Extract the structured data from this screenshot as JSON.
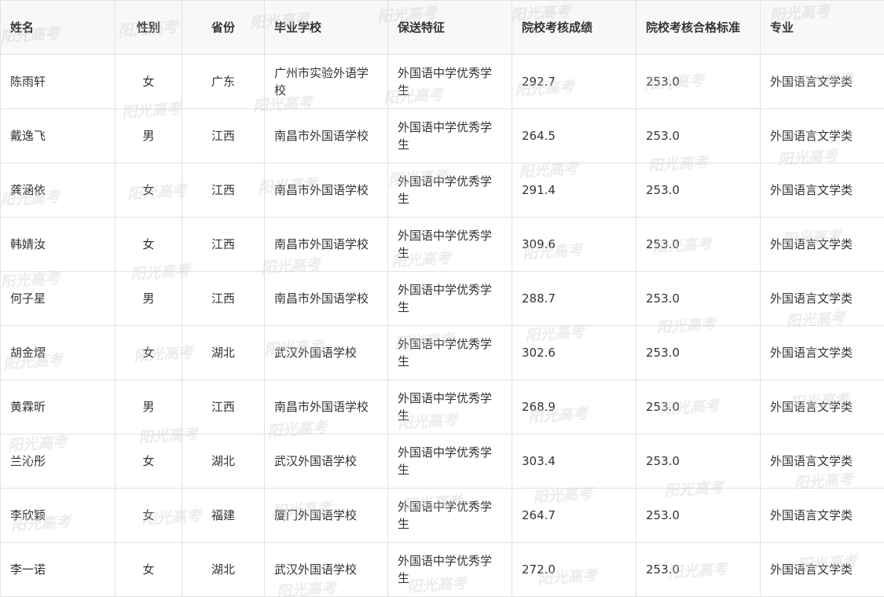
{
  "headers": {
    "name": "姓名",
    "gender": "性别",
    "province": "省份",
    "school": "毕业学校",
    "feature": "保送特征",
    "score": "院校考核成绩",
    "standard": "院校考核合格标准",
    "major": "专业"
  },
  "rows": [
    {
      "name": "陈雨轩",
      "gender": "女",
      "province": "广东",
      "school": "广州市实验外语学校",
      "feature": "外国语中学优秀学生",
      "score": "292.7",
      "standard": "253.0",
      "major": "外国语言文学类"
    },
    {
      "name": "戴逸飞",
      "gender": "男",
      "province": "江西",
      "school": "南昌市外国语学校",
      "feature": "外国语中学优秀学生",
      "score": "264.5",
      "standard": "253.0",
      "major": "外国语言文学类"
    },
    {
      "name": "龚涵依",
      "gender": "女",
      "province": "江西",
      "school": "南昌市外国语学校",
      "feature": "外国语中学优秀学生",
      "score": "291.4",
      "standard": "253.0",
      "major": "外国语言文学类"
    },
    {
      "name": "韩婧汝",
      "gender": "女",
      "province": "江西",
      "school": "南昌市外国语学校",
      "feature": "外国语中学优秀学生",
      "score": "309.6",
      "standard": "253.0",
      "major": "外国语言文学类"
    },
    {
      "name": "何子星",
      "gender": "男",
      "province": "江西",
      "school": "南昌市外国语学校",
      "feature": "外国语中学优秀学生",
      "score": "288.7",
      "standard": "253.0",
      "major": "外国语言文学类"
    },
    {
      "name": "胡金熠",
      "gender": "女",
      "province": "湖北",
      "school": "武汉外国语学校",
      "feature": "外国语中学优秀学生",
      "score": "302.6",
      "standard": "253.0",
      "major": "外国语言文学类"
    },
    {
      "name": "黄霖昕",
      "gender": "男",
      "province": "江西",
      "school": "南昌市外国语学校",
      "feature": "外国语中学优秀学生",
      "score": "268.9",
      "standard": "253.0",
      "major": "外国语言文学类"
    },
    {
      "name": "兰沁彤",
      "gender": "女",
      "province": "湖北",
      "school": "武汉外国语学校",
      "feature": "外国语中学优秀学生",
      "score": "303.4",
      "standard": "253.0",
      "major": "外国语言文学类"
    },
    {
      "name": "李欣颖",
      "gender": "女",
      "province": "福建",
      "school": "厦门外国语学校",
      "feature": "外国语中学优秀学生",
      "score": "264.7",
      "standard": "253.0",
      "major": "外国语言文学类"
    },
    {
      "name": "李一诺",
      "gender": "女",
      "province": "湖北",
      "school": "武汉外国语学校",
      "feature": "外国语中学优秀学生",
      "score": "272.0",
      "standard": "253.0",
      "major": "外国语言文学类"
    }
  ],
  "watermark": "阳光高考"
}
